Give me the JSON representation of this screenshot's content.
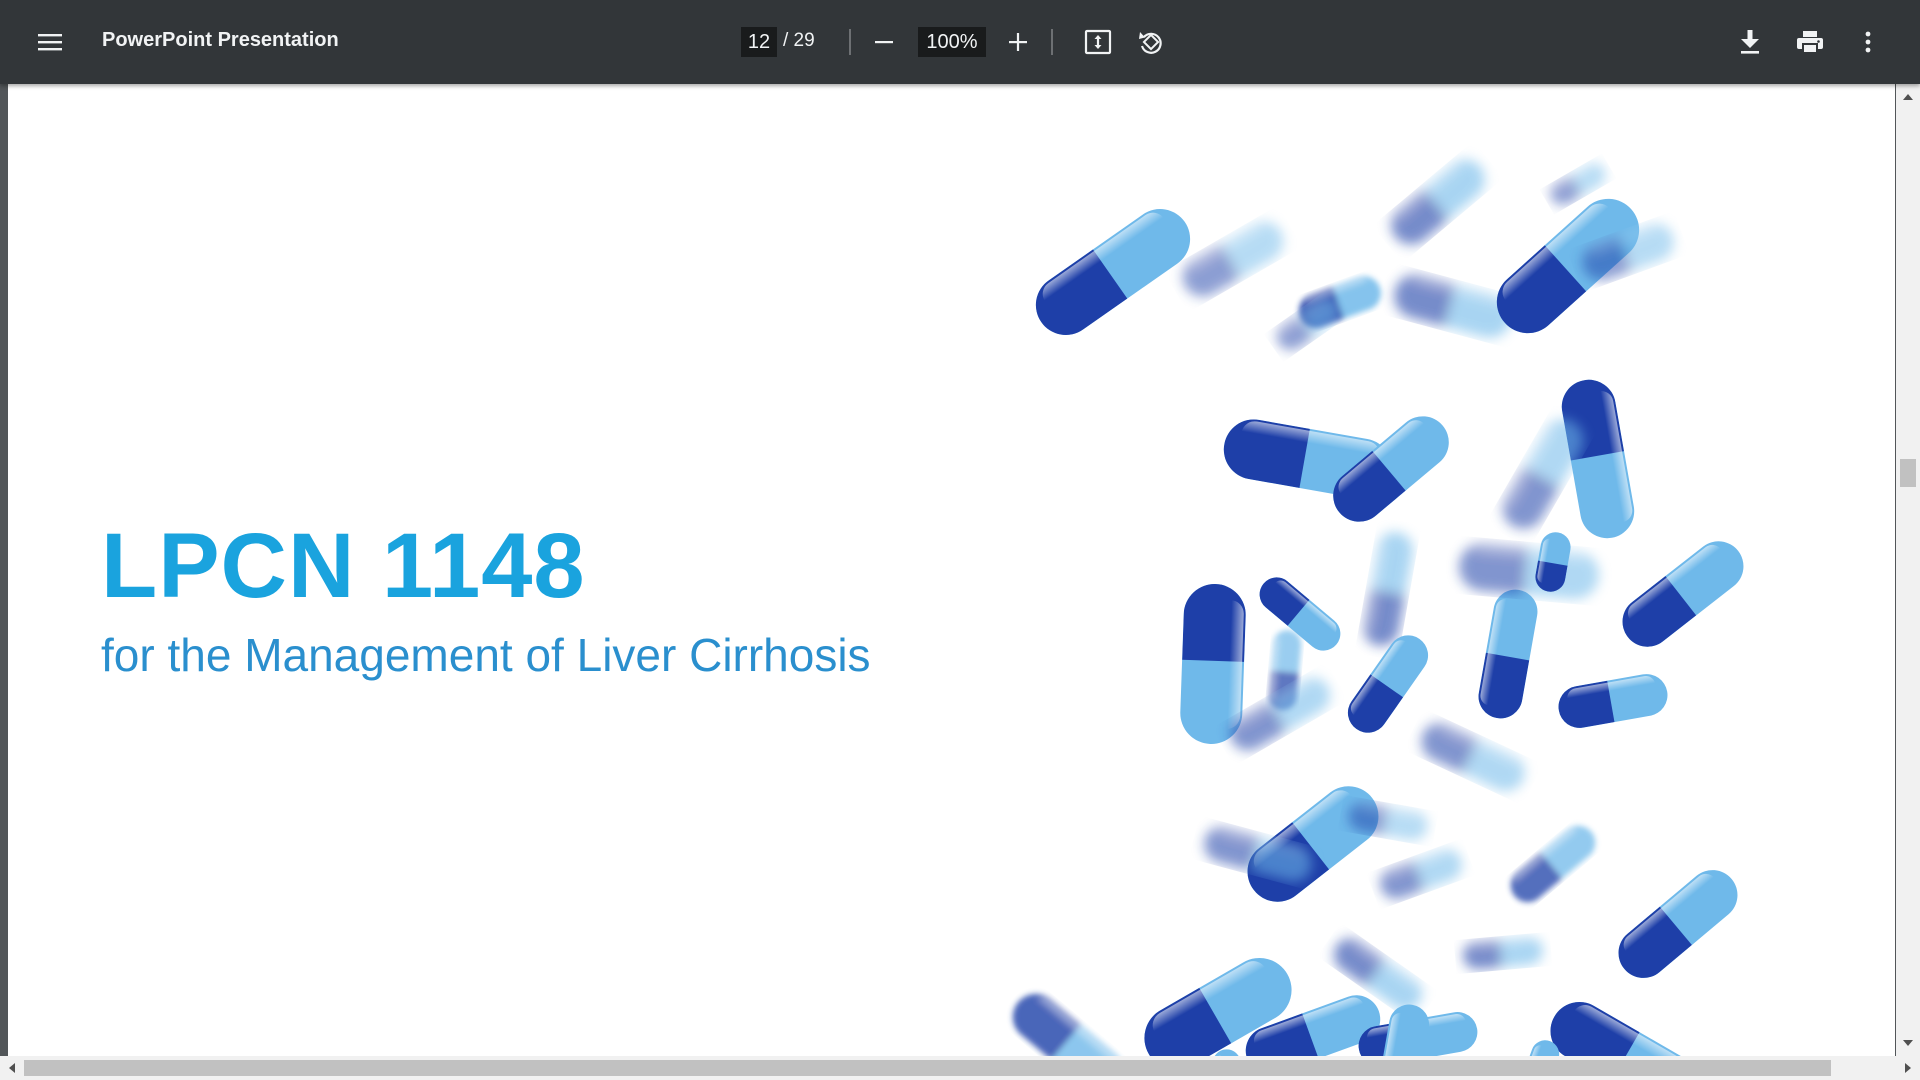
{
  "toolbar": {
    "title": "PowerPoint Presentation",
    "page_current": "12",
    "page_total": "/ 29",
    "zoom": "100%",
    "icons": {
      "menu": "menu-icon",
      "zoom_out": "minus-icon",
      "zoom_in": "plus-icon",
      "fit": "fit-to-page-icon",
      "rotate": "rotate-icon",
      "download": "download-icon",
      "print": "print-icon",
      "more": "more-vert-icon"
    }
  },
  "slide": {
    "title": "LPCN 1148",
    "subtitle": "for the Management of Liver Cirrhosis",
    "image": "falling-blue-capsules-image"
  },
  "colors": {
    "toolbar_bg": "#323639",
    "viewer_bg": "#525659",
    "title_color": "#1aa3de",
    "subtitle_color": "#2a8fce",
    "capsule_dark": "#1e3fa8",
    "capsule_light": "#6fb9ea"
  }
}
